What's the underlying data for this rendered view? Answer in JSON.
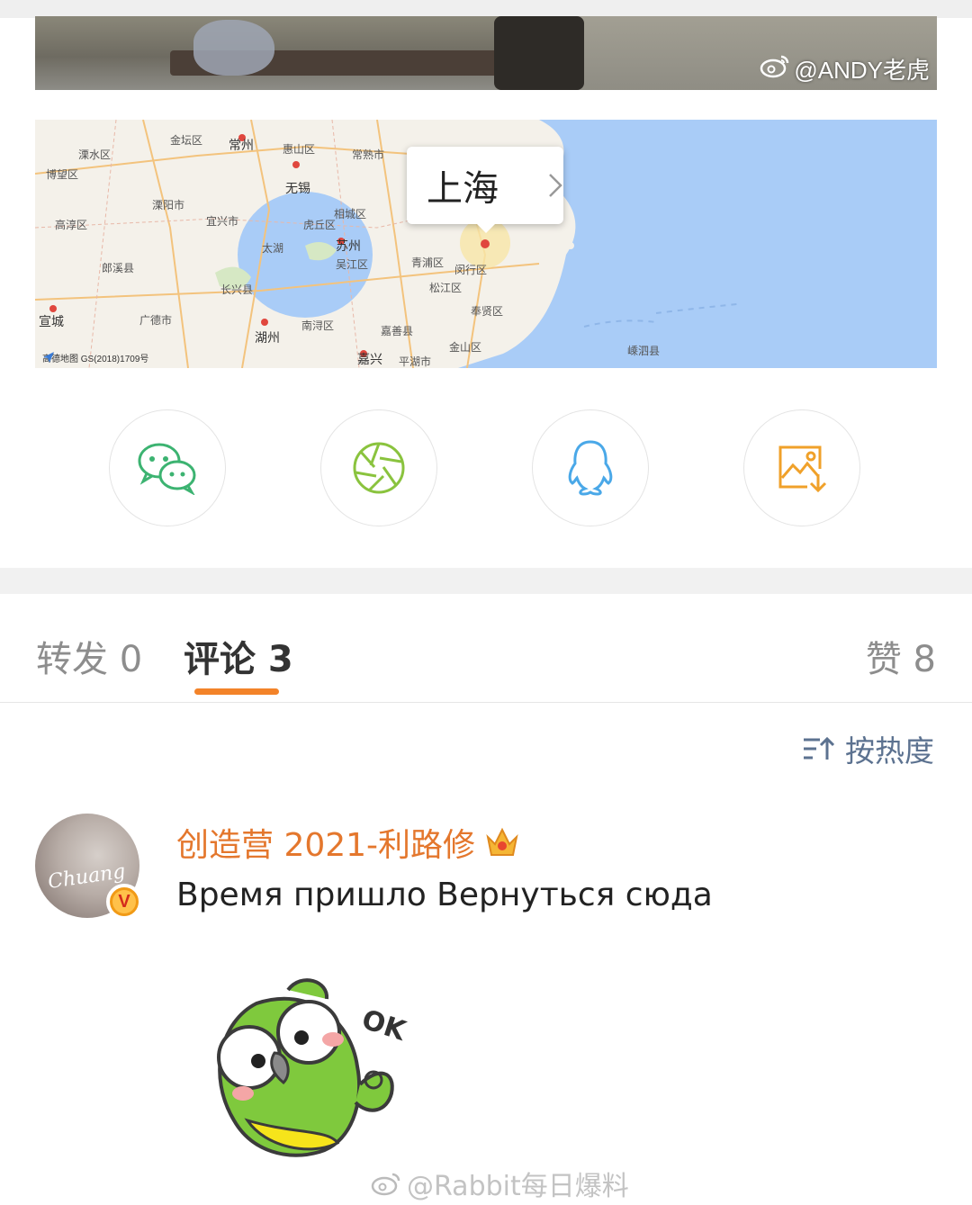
{
  "photo": {
    "watermark": "@ANDY老虎",
    "watermark_icon": "weibo-icon"
  },
  "map": {
    "popup_label": "上海",
    "credit": "高德地图 GS(2018)1709号",
    "places": [
      {
        "name": "溧水区"
      },
      {
        "name": "博望区"
      },
      {
        "name": "金坛区"
      },
      {
        "name": "常州"
      },
      {
        "name": "惠山区"
      },
      {
        "name": "常熟市"
      },
      {
        "name": "无锡"
      },
      {
        "name": "溧阳市"
      },
      {
        "name": "宜兴市"
      },
      {
        "name": "高淳区"
      },
      {
        "name": "太湖"
      },
      {
        "name": "相城区"
      },
      {
        "name": "虎丘区"
      },
      {
        "name": "苏州"
      },
      {
        "name": "吴江区"
      },
      {
        "name": "青浦区"
      },
      {
        "name": "闵行区"
      },
      {
        "name": "松江区"
      },
      {
        "name": "郎溪县"
      },
      {
        "name": "长兴县"
      },
      {
        "name": "宣城"
      },
      {
        "name": "广德市"
      },
      {
        "name": "湖州"
      },
      {
        "name": "南浔区"
      },
      {
        "name": "嘉善县"
      },
      {
        "name": "奉贤区"
      },
      {
        "name": "金山区"
      },
      {
        "name": "嘉兴"
      },
      {
        "name": "平湖市"
      },
      {
        "name": "嵊泗县"
      }
    ]
  },
  "share": [
    {
      "name": "wechat",
      "icon": "wechat-icon",
      "color": "#3cb371"
    },
    {
      "name": "moments",
      "icon": "moments-icon",
      "color": "#8ac33e"
    },
    {
      "name": "qq",
      "icon": "qq-icon",
      "color": "#4aa8e8"
    },
    {
      "name": "save-image",
      "icon": "save-image-icon",
      "color": "#f0a12a"
    }
  ],
  "tabs": {
    "repost": "转发 0",
    "comments": "评论 3",
    "likes": "赞 8"
  },
  "sort": {
    "label": "按热度",
    "icon": "sort-icon"
  },
  "comment": {
    "username": "创造营 2021-利路修",
    "avatar_text": "Chuang",
    "text": "Время пришло Вернуться сюда",
    "badge": "V",
    "sticker": "parrot-ok-sticker",
    "sticker_text": "OK"
  },
  "footer": {
    "watermark": "@Rabbit每日爆料"
  },
  "colors": {
    "accent": "#f38329",
    "username": "#e4772d",
    "sort": "#5c7290"
  }
}
